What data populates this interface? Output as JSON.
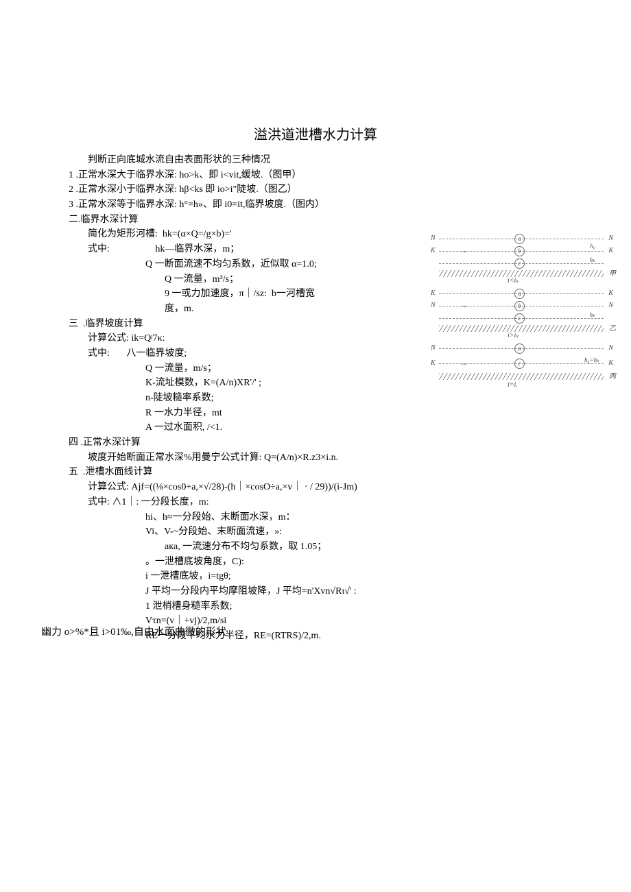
{
  "title": "溢洪道泄槽水力计算",
  "lines": {
    "l1": "判断正向底城水流自由表面形状的三种情况",
    "l2": "1 .正常水深大于临界水深: ho>k、即 i<vit,缓坡.（图甲）",
    "l3": "2 .正常水深小于临界水深: hβ<ks 即 io>i\"陡坡.（图乙）",
    "l4": "3 .正常水深等于临界水深: h°=h»、即 i0=it,临界坡度.（图内）",
    "l5": "二.临界水深计算",
    "l6": "简化为矩形河槽:  hk=(α×Q=/g×b)='",
    "l7": "式中:                   hk—临界水深，m；",
    "l8": "Q 一断面流速不均匀系数，近似取 α=1.0;",
    "l9": "Q 一流量，m³/s；",
    "l10": "9 一或力加速度，π｜/sz:  b一河槽宽",
    "l11": "度，m.",
    "l12": "三  .临界坡度计算",
    "l13": "计算公式: ik=Qʲ7κ:",
    "l14": "式中:       八一临界坡度;",
    "l15": "Q 一流量，m/s；",
    "l16": "K-流址模数，K=(A/n)XR'/' ;",
    "l17": "n-陡坡糙率系数;",
    "l18": "R 一水力半径，mt",
    "l19": "A 一过水面积, /<1.",
    "l20": "四 .正常水深计算",
    "l21": "坡度开始断面正常水深%用曼宁公式计算: Q=(A/n)×R.z3×i.n.",
    "l22": "五  .泄槽水面线计算",
    "l23": "计算公式: Ajf=((⅛×cos0+a,×√/28)-(h｜×cosO÷a,×v｜ · / 29))/(i-Jm)",
    "l24": "式中: ∧1｜: 一分段长度，m:",
    "l25": "hi、h≈一分段始、末断面水深，m：",
    "l26": "Vi、V-~分段始、末断面流速，»:",
    "l27": "aкa, 一流速分布不均匀系数，取 1.05；",
    "l28": "。一泄槽底坡角度，C):",
    "l29": "i 一泄槽底坡，i=tgθ;",
    "l30": "J 平均一分段内平均摩阻坡降，J 平均=n'Xvn√Rι√' :",
    "l31": "1 泄梢槽身糙率系数;",
    "l32": "Vτn=(v｜+vj)/2,m/si",
    "l33": "RE一分段平均水力半径，RE=(RTRS)/2,m."
  },
  "bottom": "幽力 o>%*且 i>01‰,自由水面曲微的形状",
  "fig": {
    "rowLabels": [
      "甲",
      "乙",
      "丙"
    ],
    "mid1": "i<iₖ",
    "mid2": "i>iₖ",
    "mid3": "i=i.",
    "h0": "h₀",
    "hk": "hₖ",
    "eq": "h₀=hₖ"
  }
}
